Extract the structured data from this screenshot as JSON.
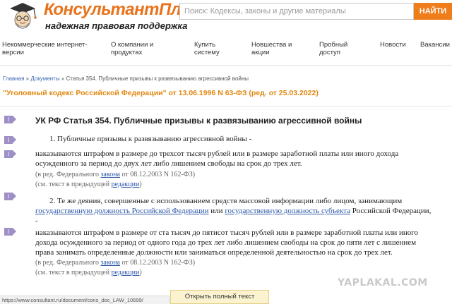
{
  "brand": {
    "title": "КонсультантПлюс",
    "subtitle": "надежная правовая поддержка",
    "accent": "#ef7d1a"
  },
  "search": {
    "placeholder": "Поиск: Кодексы, законы и другие материалы",
    "button": "НАЙТИ"
  },
  "nav": [
    {
      "line1": "Некоммерческие интернет-",
      "line2": "версии"
    },
    {
      "line1": "О компании и",
      "line2": "продуктах"
    },
    {
      "line1": "Купить",
      "line2": "систему"
    },
    {
      "line1": "Новшества и",
      "line2": "акции"
    },
    {
      "line1": "Пробный",
      "line2": "доступ"
    },
    {
      "line1": "Новости",
      "line2": ""
    },
    {
      "line1": "Вакансии",
      "line2": ""
    }
  ],
  "breadcrumb": {
    "home": "Главная",
    "sep1": " » ",
    "documents": "Документы",
    "sep2": " » ",
    "current": "Статья 354. Публичные призывы к развязыванию агрессивной войны"
  },
  "document_link": "\"Уголовный кодекс Российской Федерации\" от 13.06.1996 N 63-ФЗ (ред. от 25.03.2022)",
  "marker_glyph": "i",
  "article": {
    "title": "УК РФ Статья 354. Публичные призывы к развязыванию агрессивной войны",
    "p1": "1. Публичные призывы к развязыванию агрессивной войны -",
    "p1_penalty_1": "наказываются штрафом в размере до трехсот тысяч рублей или в размере заработной платы или иного дохода",
    "p1_penalty_2": "осужденного за период до двух лет либо лишением свободы на срок до трех лет.",
    "p1_note_pre": "(в ред. Федерального ",
    "p1_note_link": "закона",
    "p1_note_post": " от 08.12.2003 N 162-ФЗ)",
    "p1_see_pre": "(см. текст в предыдущей ",
    "p1_see_link": "редакции",
    "p1_see_post": ")",
    "p2_line1": "2. Те же деяния, совершенные с использованием средств массовой информации либо лицом, занимающим",
    "p2_link1": "государственную должность Российской Федерации",
    "p2_or": " или ",
    "p2_link2": "государственную должность субъекта",
    "p2_tail": " Российской Федерации,",
    "p2_dash": "-",
    "p2_penalty_1": "наказываются штрафом в размере от ста тысяч до пятисот тысяч рублей или в размере заработной платы или иного",
    "p2_penalty_2": "дохода осужденного за период от одного года до трех лет либо лишением свободы на срок до пяти лет с лишением",
    "p2_penalty_3": "права занимать определенные должности или заниматься определенной деятельностью на срок до трех лет.",
    "p2_note_pre": "(в ред. Федерального ",
    "p2_note_link": "закона",
    "p2_note_post": " от 08.12.2003 N 162-ФЗ)",
    "p2_see_pre": "(см. текст в предыдущей ",
    "p2_see_link": "редакции",
    "p2_see_post": ")"
  },
  "open_full_button": "Открыть полный текст документа",
  "status_url": "https://www.consultant.ru/document/cons_doc_LAW_10699/",
  "watermark": "YAPLAKAL.COM"
}
